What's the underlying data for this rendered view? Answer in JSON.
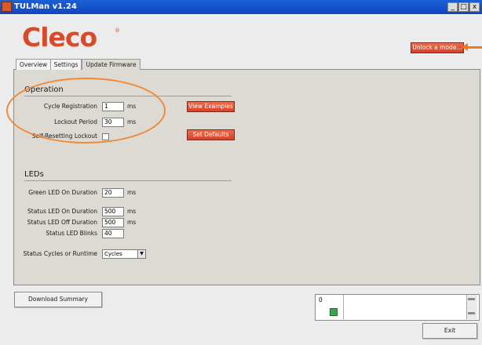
{
  "window": {
    "title": "TULMan v1.24",
    "minimize_glyph": "_",
    "maximize_glyph": "□",
    "close_glyph": "x"
  },
  "logo": {
    "text": "Cleco",
    "mark": "®",
    "color": "#d94a2a"
  },
  "unlock_button": "Unlock a mode...",
  "tabs": [
    "Overview",
    "Settings",
    "Update Firmware"
  ],
  "active_tab": "Update Firmware",
  "operation": {
    "heading": "Operation",
    "cycle_registration": {
      "label": "Cycle Registration",
      "value": "1",
      "unit": "ms"
    },
    "lockout_period": {
      "label": "Lockout Period",
      "value": "30",
      "unit": "ms"
    },
    "self_resetting_lockout": {
      "label": "Self-Resetting Lockout",
      "checked": false
    },
    "view_examples_button": "View Examples",
    "set_defaults_button": "Set Defaults"
  },
  "leds": {
    "heading": "LEDs",
    "green_on": {
      "label": "Green LED On Duration",
      "value": "20",
      "unit": "ms"
    },
    "status_on": {
      "label": "Status LED On Duration",
      "value": "500",
      "unit": "ms"
    },
    "status_off": {
      "label": "Status LED Off Duration",
      "value": "500",
      "unit": "ms"
    },
    "status_blinks": {
      "label": "Status LED Blinks",
      "value": "40"
    },
    "cycles_or_runtime": {
      "label": "Status Cycles or Runtime",
      "selected": "Cycles"
    }
  },
  "download_summary_button": "Download Summary",
  "log": {
    "value": "0"
  },
  "exit_button": "Exit",
  "colors": {
    "accent_red": "#e0533a",
    "annotation_orange": "#ef8a3a",
    "panel": "#dcdad3"
  }
}
